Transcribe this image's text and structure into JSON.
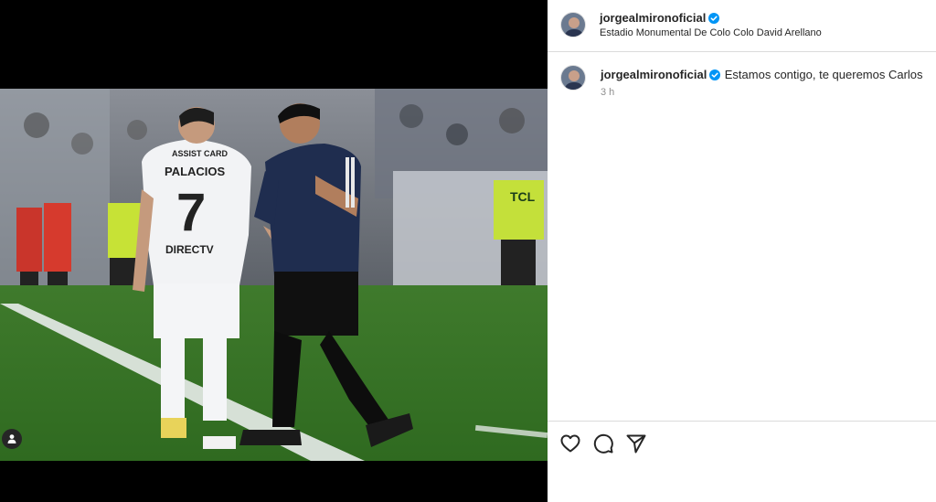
{
  "post": {
    "author": "jorgealmironoficial",
    "location": "Estadio Monumental De Colo Colo David Arellano",
    "verified": true
  },
  "photo": {
    "jersey_sponsor": "ASSIST CARD",
    "jersey_name": "PALACIOS",
    "jersey_number": "7",
    "jersey_brand": "DIRECTV",
    "referee_shirt": "TCL"
  },
  "comments": [
    {
      "author": "jorgealmironoficial",
      "text": "Estamos contigo, te queremos Carlos",
      "time": "3 h"
    }
  ],
  "icons": {
    "like": "heart-icon",
    "comment": "comment-icon",
    "share": "send-icon",
    "tag": "user-tag-icon"
  },
  "colors": {
    "verified": "#0095f6",
    "text": "#262626",
    "muted": "#8e8e8e",
    "border": "#dbdbdb"
  }
}
